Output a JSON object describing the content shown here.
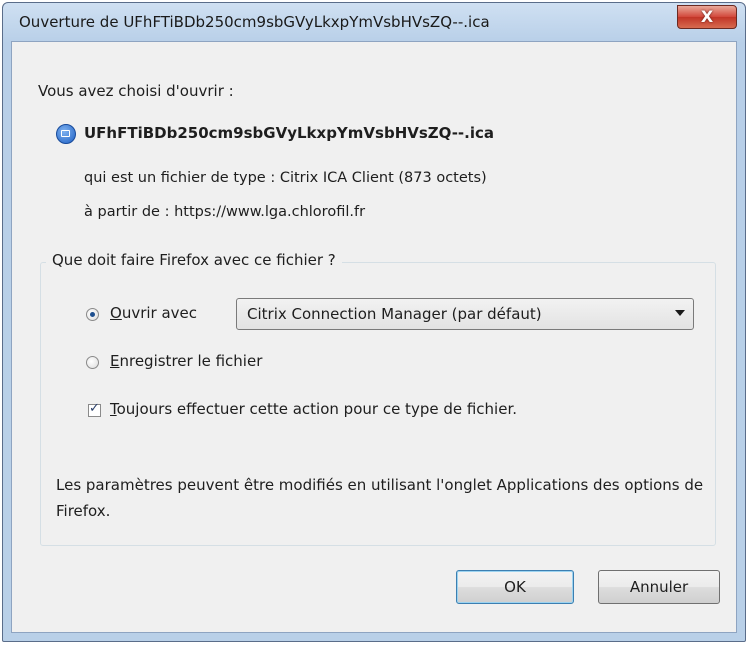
{
  "window": {
    "title": "Ouverture de UFhFTiBDb250cm9sbGVyLkxpYmVsbHVsZQ--.ica",
    "close_label": "X"
  },
  "intro": "Vous avez choisi d'ouvrir :",
  "file": {
    "icon": "citrix-file-icon",
    "name": "UFhFTiBDb250cm9sbGVyLkxpYmVsbHVsZQ--.ica",
    "type_label": "qui est un fichier de type :",
    "type_value": "Citrix ICA Client (873 octets)",
    "from_label": "à partir de :",
    "from_value": "https://www.lga.chlorofil.fr"
  },
  "action_group": {
    "legend": "Que doit faire Firefox avec ce fichier ?",
    "open_with": {
      "key": "O",
      "rest": "uvrir avec",
      "checked": true
    },
    "app_selected": "Citrix Connection Manager (par défaut)",
    "save": {
      "key": "E",
      "rest": "nregistrer le fichier",
      "checked": false
    },
    "always": {
      "key": "T",
      "rest": "oujours effectuer cette action pour ce type de fichier.",
      "checked": true
    },
    "note": "Les paramètres peuvent être modifiés en utilisant l'onglet Applications des options de Firefox."
  },
  "buttons": {
    "ok": "OK",
    "cancel": "Annuler"
  }
}
